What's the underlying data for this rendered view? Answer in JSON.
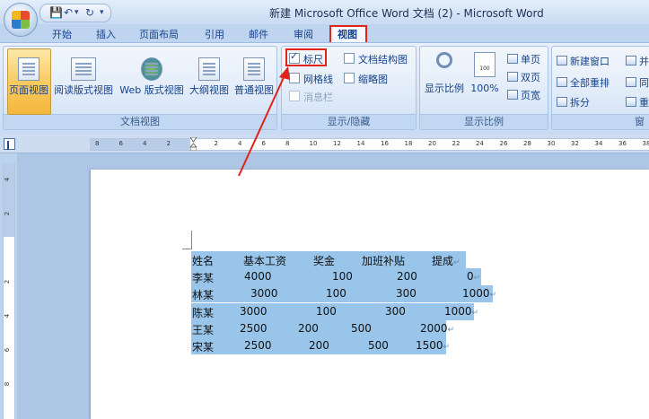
{
  "titlebar": {
    "title": "新建 Microsoft Office Word 文档 (2) - Microsoft Word",
    "qat_more": "▾",
    "qat_undo_arrow": "▾"
  },
  "tabs": [
    "开始",
    "插入",
    "页面布局",
    "引用",
    "邮件",
    "审阅",
    "视图"
  ],
  "ribbon": {
    "doc_views": {
      "label": "文档视图",
      "buttons": [
        "页面视图",
        "阅读版式视图",
        "Web 版式视图",
        "大纲视图",
        "普通视图"
      ]
    },
    "show_hide": {
      "label": "显示/隐藏",
      "items": [
        {
          "label": "标尺",
          "checked": true
        },
        {
          "label": "网格线",
          "checked": false
        },
        {
          "label": "消息栏",
          "checked": false,
          "disabled": true
        },
        {
          "label": "文档结构图",
          "checked": false
        },
        {
          "label": "缩略图",
          "checked": false
        }
      ]
    },
    "zoom": {
      "label": "显示比例",
      "zoom_button": "显示比例",
      "hundred": "100%",
      "one_page": "单页",
      "two_pages": "双页",
      "page_width": "页宽",
      "icon_value": "100"
    },
    "window": {
      "new_window": "新建窗口",
      "arrange_all": "全部重排",
      "split": "拆分",
      "side_by_side": "并",
      "sync": "同",
      "reset": "重",
      "label_partial": "窗"
    }
  },
  "ruler": {
    "ticks": [
      "8",
      "6",
      "4",
      "2",
      "",
      "2",
      "4",
      "6",
      "8",
      "10",
      "12",
      "14",
      "16",
      "18",
      "20",
      "22",
      "24",
      "26",
      "28",
      "30",
      "32",
      "34",
      "36",
      "38"
    ]
  },
  "vruler": {
    "ticks": [
      "4",
      "2",
      "",
      "2",
      "4",
      "6",
      "8"
    ]
  },
  "document": {
    "table": {
      "headers": [
        "姓名",
        "基本工资",
        "奖金",
        "加班补贴",
        "提成"
      ],
      "rows": [
        [
          "李某",
          "4000",
          "100",
          "200",
          "0"
        ],
        [
          "林某",
          "3000",
          "100",
          "300",
          "1000"
        ],
        [
          "陈某",
          "3000",
          "100",
          "300",
          "1000"
        ],
        [
          "王某",
          "2500",
          "200",
          "500",
          "2000"
        ],
        [
          "宋某",
          "2500",
          "200",
          "500",
          "1500"
        ]
      ]
    },
    "para_mark": "↵"
  },
  "colors": {
    "highlight": "#e2231a",
    "selection": "#99c5eb",
    "ribbon": "#d4e3f6"
  }
}
